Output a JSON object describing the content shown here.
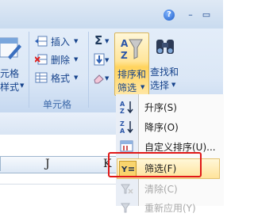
{
  "colors": {
    "accent_red": "#e01818",
    "ribbon_bg": "#dbe7f6",
    "highlight": "#ffe59a"
  },
  "window": {
    "help_icon": "?",
    "minimize_glyph": "–",
    "restore_glyph": "▭"
  },
  "ribbon": {
    "styles_partial": {
      "line1": "元格",
      "line2": "样式"
    },
    "cells_group": {
      "insert": "插入",
      "delete": "删除",
      "format": "格式",
      "label": "单元格"
    },
    "editing": {
      "sigma_icon": "Σ",
      "sort_filter": {
        "line1": "排序和",
        "line2": "筛选"
      },
      "find_select": {
        "line1": "查找和",
        "line2": "选择"
      }
    }
  },
  "sheet": {
    "columns": [
      "J",
      "K"
    ]
  },
  "menu": {
    "items": [
      {
        "label": "升序(S)",
        "icon": "sort-ascending-icon"
      },
      {
        "label": "降序(O)",
        "icon": "sort-descending-icon"
      },
      {
        "label": "自定义排序(U)...",
        "icon": "custom-sort-icon"
      },
      {
        "label": "筛选(F)",
        "icon": "filter-icon"
      },
      {
        "label": "清除(C)",
        "icon": "clear-filter-icon"
      },
      {
        "label": "重新应用(Y)",
        "icon": "reapply-icon"
      }
    ]
  }
}
